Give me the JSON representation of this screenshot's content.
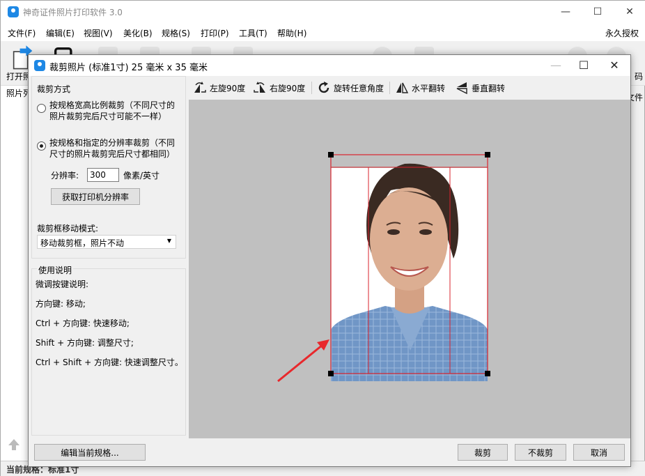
{
  "app": {
    "title": "神奇证件照片打印软件 3.0",
    "license": "永久授权"
  },
  "menu": [
    "文件(F)",
    "编辑(E)",
    "视图(V)",
    "美化(B)",
    "规格(S)",
    "打印(P)",
    "工具(T)",
    "帮助(H)"
  ],
  "toolbar": {
    "open_label": "打开照"
  },
  "left_panel": {
    "header": "照片列"
  },
  "right_strip": {
    "top": "码",
    "bottom": "文件"
  },
  "status": {
    "text": "当前规格：标准1寸"
  },
  "dialog": {
    "title": "裁剪照片 (标准1寸) 25 毫米 x 35 毫米",
    "crop_mode": {
      "title": "裁剪方式",
      "option1": "按规格宽高比例裁剪（不同尺寸的照片裁剪完后尺寸可能不一样）",
      "option2": "按规格和指定的分辨率裁剪（不同尺寸的照片裁剪完后尺寸都相同）",
      "selected": 2,
      "resolution_label": "分辨率:",
      "resolution_value": "300",
      "resolution_unit": "像素/英寸",
      "get_printer_res_button": "获取打印机分辨率",
      "move_mode_label": "裁剪框移动模式:",
      "move_mode_value": "移动裁剪框，照片不动"
    },
    "instructions": {
      "title": "使用说明",
      "lines": [
        "微调按键说明:",
        "方向键: 移动;",
        "Ctrl + 方向键: 快速移动;",
        "Shift + 方向键: 调整尺寸;",
        "Ctrl + Shift + 方向键: 快速调整尺寸。"
      ]
    },
    "tools": {
      "rotate_left": "左旋90度",
      "rotate_right": "右旋90度",
      "rotate_any": "旋转任意角度",
      "flip_h": "水平翻转",
      "flip_v": "垂直翻转"
    },
    "buttons": {
      "edit_spec": "编辑当前规格...",
      "crop": "裁剪",
      "no_crop": "不裁剪",
      "cancel": "取消"
    }
  },
  "colors": {
    "crop_frame": "#d9232d",
    "annotation_arrow": "#e8282c",
    "accent": "#1e88e5",
    "canvas_bg": "#c0c0c0",
    "jacket": "#6f93c2"
  }
}
